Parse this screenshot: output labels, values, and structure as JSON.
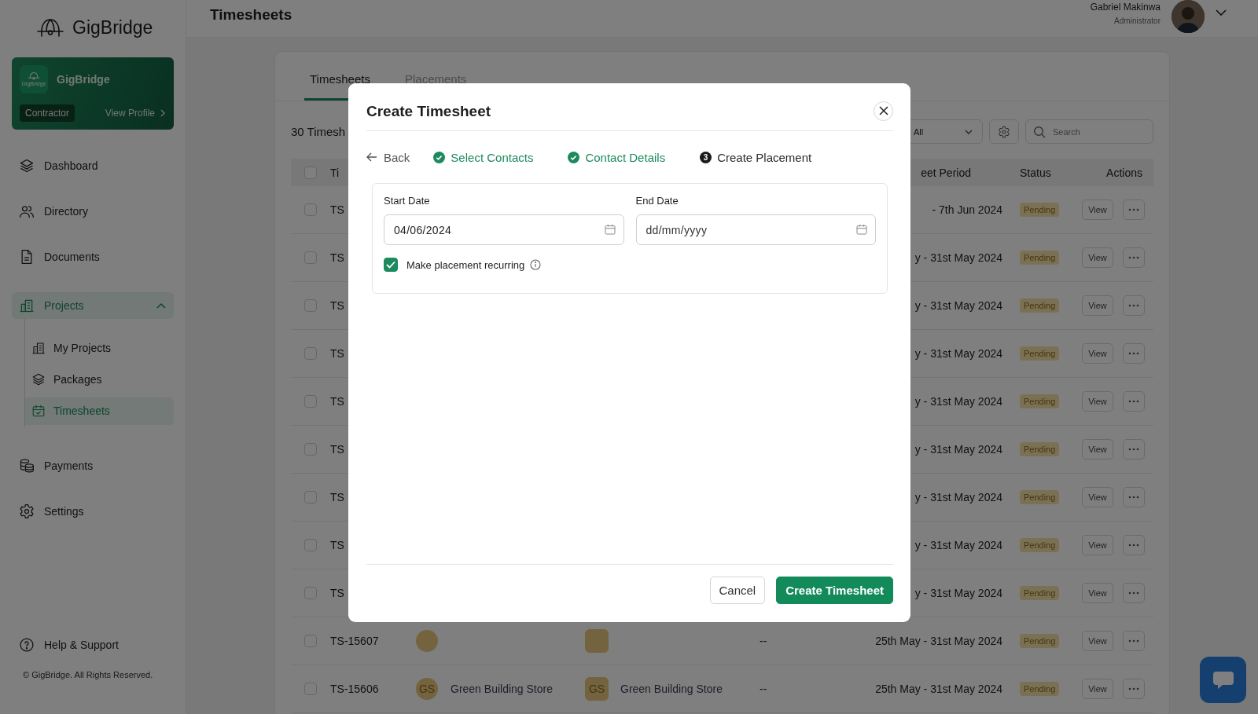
{
  "sidebar": {
    "brand": "GigBridge",
    "profile": {
      "logo_text": "GigBridge",
      "name": "GigBridge",
      "role": "Contractor",
      "link": "View Profile"
    },
    "nav": [
      {
        "label": "Dashboard",
        "selected": false
      },
      {
        "label": "Directory",
        "selected": false
      },
      {
        "label": "Documents",
        "selected": false
      },
      {
        "label": "Projects",
        "selected": true,
        "expanded": true,
        "children": [
          {
            "label": "My Projects",
            "selected": false
          },
          {
            "label": "Packages",
            "selected": false
          },
          {
            "label": "Timesheets",
            "selected": true
          }
        ]
      },
      {
        "label": "Payments",
        "selected": false
      },
      {
        "label": "Settings",
        "selected": false
      }
    ],
    "help": "Help & Support",
    "copyright": "© GigBridge. All Rights Reserved."
  },
  "header": {
    "title": "Timesheets",
    "user": {
      "name": "Gabriel Makinwa",
      "role": "Administrator"
    }
  },
  "tabs": [
    {
      "label": "Timesheets",
      "selected": true
    },
    {
      "label": "Placements",
      "selected": false
    }
  ],
  "toolbar": {
    "count": "30 Timesh",
    "filter": "All",
    "search": {
      "placeholder": "Search"
    }
  },
  "table": {
    "all_checked": false,
    "columns": {
      "id": "Ti",
      "period": "eet Period",
      "status": "Status",
      "actions": "Actions"
    },
    "rows": [
      {
        "checked": false,
        "id": "TS",
        "period": "- 7th Jun 2024",
        "status": "Pending",
        "action": "View"
      },
      {
        "checked": false,
        "id": "TS",
        "period": "y - 31st May 2024",
        "status": "Pending",
        "action": "View"
      },
      {
        "checked": false,
        "id": "TS",
        "period": "y - 31st May 2024",
        "status": "Pending",
        "action": "View"
      },
      {
        "checked": false,
        "id": "TS",
        "period": "y - 31st May 2024",
        "status": "Pending",
        "action": "View"
      },
      {
        "checked": false,
        "id": "TS",
        "period": "y - 31st May 2024",
        "status": "Pending",
        "action": "View"
      },
      {
        "checked": false,
        "id": "TS",
        "period": "y - 31st May 2024",
        "status": "Pending",
        "action": "View"
      },
      {
        "checked": false,
        "id": "TS",
        "period": "y - 31st May 2024",
        "status": "Pending",
        "action": "View"
      },
      {
        "checked": false,
        "id": "TS",
        "period": "y - 31st May 2024",
        "status": "Pending",
        "action": "View"
      },
      {
        "checked": false,
        "id": "TS",
        "period": "y - 31st May 2024",
        "status": "Pending",
        "action": "View"
      },
      {
        "checked": false,
        "id": "TS-15607",
        "contact": {
          "kind": "avatar"
        },
        "company": {
          "kind": "avatar"
        },
        "reference": "--",
        "period": "25th May - 31st May 2024",
        "status": "Pending",
        "action": "View"
      },
      {
        "checked": false,
        "id": "TS-15606",
        "contact": {
          "kind": "avatar",
          "initials": "GS",
          "name": "Green Building Store"
        },
        "company": {
          "kind": "avatar",
          "initials": "GS",
          "name": "Green Building Store"
        },
        "reference": "--",
        "period": "25th May - 31st May 2024",
        "status": "Pending",
        "action": "View"
      }
    ]
  },
  "modal": {
    "title": "Create Timesheet",
    "back": "Back",
    "steps": [
      {
        "label": "Select Contacts",
        "completed": true
      },
      {
        "label": "Contact Details",
        "completed": true
      },
      {
        "label": "Create Placement",
        "completed": false,
        "number": "3"
      }
    ],
    "fields": [
      {
        "label": "Start Date",
        "value": "04/06/2024"
      },
      {
        "label": "End Date",
        "placeholder": "dd/mm/yyyy"
      }
    ],
    "recurring": {
      "label": "Make placement recurring",
      "checked": true
    },
    "buttons": [
      {
        "label": "Cancel",
        "kind": "secondary"
      },
      {
        "label": "Create Timesheet",
        "kind": "primary"
      }
    ]
  }
}
